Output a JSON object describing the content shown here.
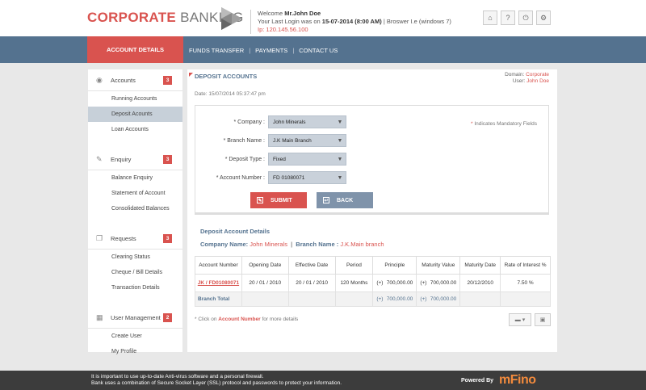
{
  "header": {
    "brand_part1": "CORPORATE",
    "brand_part2": "BANKING",
    "welcome_prefix": "Welcome",
    "user_name": "Mr.John Doe",
    "last_login_prefix": "Your Last Login was on",
    "last_login_value": "15-07-2014 (8:00 AM)",
    "browser": "| Broswer I.e (windows 7)",
    "ip": "Ip: 120.145.56.100",
    "icons": [
      "home-icon",
      "help-icon",
      "power-icon",
      "settings-icon"
    ]
  },
  "nav": {
    "active": "ACCOUNT DETAILS",
    "links": [
      "FUNDS TRANSFER",
      "PAYMENTS",
      "CONTACT US"
    ]
  },
  "sidebar": {
    "sections": [
      {
        "label": "Accounts",
        "badge": "3",
        "items": [
          "Running Accounts",
          "Deposit Acounts",
          "Loan Accounts"
        ],
        "active": 1
      },
      {
        "label": "Enquiry",
        "badge": "3",
        "items": [
          "Balance Enquiry",
          "Statement of Account",
          "Consolidated Balances"
        ],
        "active": -1
      },
      {
        "label": "Requests",
        "badge": "3",
        "items": [
          "Clearing Status",
          "Cheque / Bill Details",
          "Transaction Details"
        ],
        "active": -1
      },
      {
        "label": "User Management",
        "badge": "2",
        "items": [
          "Create User",
          "My Profile"
        ],
        "active": -1
      }
    ]
  },
  "main": {
    "title": "DEPOSIT ACCOUNTS",
    "domain_label": "Domain:",
    "domain_value": "Corporate",
    "user_label": "User:",
    "user_value": "John Doe",
    "date": "Date: 15/07/2014 05:37:47 pm",
    "mandatory_text": "Indicates Mandatory Fields",
    "form": {
      "company_label": "* Company :",
      "company_value": "John Minerals",
      "branch_label": "* Branch Name :",
      "branch_value": "J.K Main Branch",
      "deposit_label": "* Deposit Type :",
      "deposit_value": "Fixed",
      "account_label": "* Account Number :",
      "account_value": "FD 01080071",
      "submit": "SUBMIT",
      "back": "BACK"
    },
    "details": {
      "title": "Deposit Account Details",
      "company_label": "Company Name:",
      "company_value": "John Minerals",
      "branch_label": "Branch Name :",
      "branch_value": "J.K.Main branch",
      "columns": [
        "Account Number",
        "Opening Date",
        "Effective Date",
        "Period",
        "Principle",
        "Maturity Value",
        "Maturity Date",
        "Rate of Interest %"
      ],
      "row": {
        "account": "JK / FD01080071",
        "opening": "20 / 01 / 2010",
        "effective": "20 / 01 / 2010",
        "period": "120 Months",
        "principle_sign": "(+)",
        "principle": "700,000.00",
        "maturity_sign": "(+)",
        "maturity": "700,000.00",
        "maturity_date": "20/12/2010",
        "rate": "7.50 %"
      },
      "total": {
        "label": "Branch Total",
        "principle_sign": "(+)",
        "principle": "700,000.00",
        "maturity_sign": "(+)",
        "maturity": "700,000.00"
      }
    },
    "note_prefix": "* Click on",
    "note_link": "Account Number",
    "note_suffix": "for more details"
  },
  "footer": {
    "line1": "It is important to use up-to-date Anti-virus software and a personal firewall.",
    "line2": "Bank uses a combination of Secure Socket Layer (SSL) protocol and passwords to protect your information.",
    "powered": "Powered By",
    "brand": "mFino"
  }
}
